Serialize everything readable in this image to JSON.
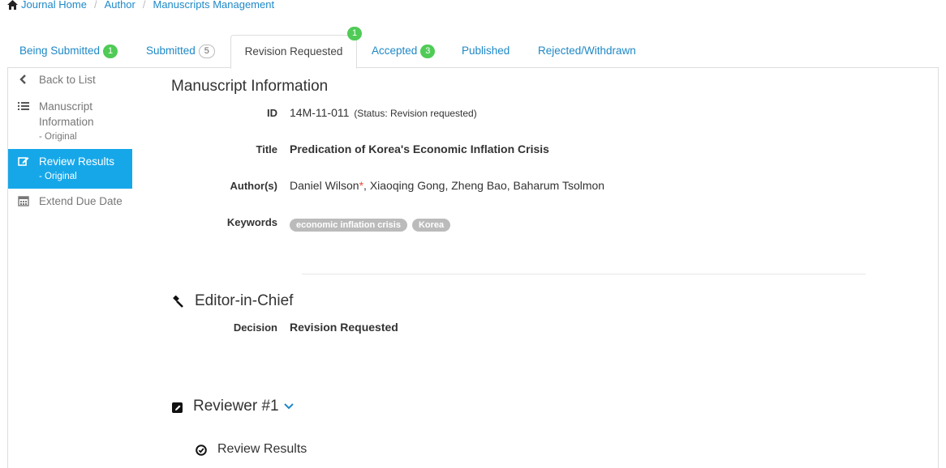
{
  "breadcrumb": {
    "items": [
      "Journal Home",
      "Author",
      "Manuscripts Management"
    ]
  },
  "tabs": [
    {
      "label": "Being Submitted",
      "badge": "1"
    },
    {
      "label": "Submitted",
      "badge": "5"
    },
    {
      "label": "Revision Requested",
      "badge": "1"
    },
    {
      "label": "Accepted",
      "badge": "3"
    },
    {
      "label": "Published"
    },
    {
      "label": "Rejected/Withdrawn"
    }
  ],
  "sidebar": {
    "back": "Back to List",
    "items": [
      {
        "label1": "Manuscript",
        "label2": "Information",
        "sub": "- Original"
      },
      {
        "label1": "Review Results",
        "sub": "- Original"
      },
      {
        "label1": "Extend Due Date"
      }
    ]
  },
  "manuscript": {
    "title": "Manuscript Information",
    "id_label": "ID",
    "id_value": "14M-11-011",
    "status": "(Status: Revision requested)",
    "title_label": "Title",
    "title_value": "Predication of Korea's Economic Inflation Crisis",
    "authors_label": "Author(s)",
    "authors_first": "Daniel Wilson",
    "authors_mark": "*",
    "authors_rest": ", Xiaoqing Gong, Zheng Bao, Baharum Tsolmon",
    "keywords_label": "Keywords",
    "keywords": [
      "economic inflation crisis",
      "Korea"
    ]
  },
  "editor": {
    "title": "Editor-in-Chief",
    "decision_label": "Decision",
    "decision_value": "Revision Requested"
  },
  "reviewer": {
    "title": "Reviewer #1",
    "results_title": "Review Results"
  },
  "colors": {
    "link": "#1e88c7",
    "active": "#16a7e9",
    "badge": "#4fcb56",
    "required": "#e74c3c"
  }
}
